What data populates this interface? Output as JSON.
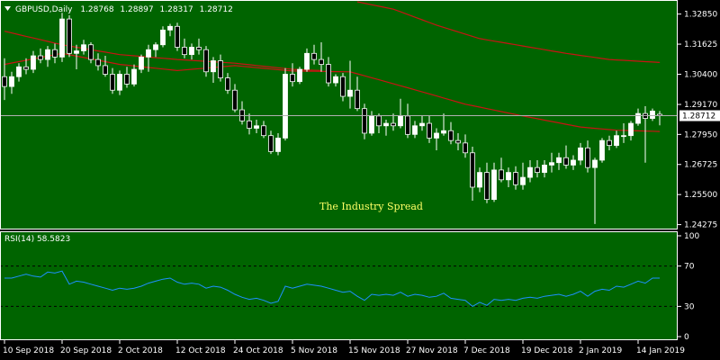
{
  "colors": {
    "background": "#006400",
    "frame": "#000000",
    "grid": "#009b00",
    "axis_text": "#ffffff",
    "bull": "#ffffff",
    "bear": "#000000",
    "wick": "#ffffff",
    "ma": "#c81414",
    "rsi": "#1e90ff",
    "price_line": "#b0b0b0",
    "watermark": "#ffff66"
  },
  "header": {
    "symbol": "GBPUSD,Daily",
    "open": "1.28768",
    "high": "1.28897",
    "low": "1.28317",
    "close": "1.28712"
  },
  "watermark": "The Industry Spread",
  "rsi_panel": {
    "label": "RSI(14) 58.5823",
    "levels": [
      "100",
      "70",
      "30",
      "0"
    ]
  },
  "chart_data": [
    {
      "type": "candlestick",
      "title": "GBPUSD,Daily",
      "grid": false,
      "ylim": [
        1.2415,
        1.3335
      ],
      "y_ticks": [
        "1.32850",
        "1.31625",
        "1.30400",
        "1.29170",
        "1.27950",
        "1.26725",
        "1.25500",
        "1.24275"
      ],
      "current_price": "1.28712",
      "x_tick_labels": [
        "10 Sep 2018",
        "20 Sep 2018",
        "2 Oct 2018",
        "12 Oct 2018",
        "24 Oct 2018",
        "5 Nov 2018",
        "15 Nov 2018",
        "27 Nov 2018",
        "7 Dec 2018",
        "19 Dec 2018",
        "2 Jan 2019",
        "14 Jan 2019"
      ],
      "x_tick_index": [
        0,
        8,
        16,
        24,
        32,
        40,
        48,
        56,
        64,
        72,
        80,
        88
      ],
      "ohlc": [
        [
          1.303,
          1.3105,
          1.2935,
          1.299
        ],
        [
          1.299,
          1.305,
          1.296,
          1.303
        ],
        [
          1.303,
          1.3085,
          1.301,
          1.307
        ],
        [
          1.307,
          1.3105,
          1.304,
          1.306
        ],
        [
          1.306,
          1.3135,
          1.3045,
          1.3115
        ],
        [
          1.3115,
          1.3145,
          1.3085,
          1.31
        ],
        [
          1.31,
          1.3155,
          1.307,
          1.314
        ],
        [
          1.314,
          1.3165,
          1.3085,
          1.311
        ],
        [
          1.311,
          1.329,
          1.309,
          1.3265
        ],
        [
          1.3265,
          1.328,
          1.311,
          1.3125
        ],
        [
          1.3125,
          1.316,
          1.306,
          1.3135
        ],
        [
          1.3135,
          1.318,
          1.312,
          1.316
        ],
        [
          1.316,
          1.317,
          1.3085,
          1.31
        ],
        [
          1.31,
          1.3125,
          1.3055,
          1.3075
        ],
        [
          1.3075,
          1.3115,
          1.303,
          1.304
        ],
        [
          1.304,
          1.3065,
          1.296,
          1.2975
        ],
        [
          1.2975,
          1.3055,
          1.2955,
          1.304
        ],
        [
          1.304,
          1.307,
          1.2985,
          1.3
        ],
        [
          1.3,
          1.308,
          1.299,
          1.306
        ],
        [
          1.306,
          1.312,
          1.3045,
          1.311
        ],
        [
          1.311,
          1.316,
          1.305,
          1.314
        ],
        [
          1.314,
          1.317,
          1.311,
          1.316
        ],
        [
          1.316,
          1.3235,
          1.315,
          1.322
        ],
        [
          1.322,
          1.3245,
          1.3195,
          1.3235
        ],
        [
          1.3235,
          1.325,
          1.3135,
          1.315
        ],
        [
          1.315,
          1.3185,
          1.3105,
          1.312
        ],
        [
          1.312,
          1.3165,
          1.31,
          1.315
        ],
        [
          1.315,
          1.3185,
          1.312,
          1.314
        ],
        [
          1.314,
          1.3155,
          1.303,
          1.305
        ],
        [
          1.305,
          1.311,
          1.3005,
          1.3095
        ],
        [
          1.3095,
          1.312,
          1.301,
          1.3025
        ],
        [
          1.3025,
          1.3045,
          1.296,
          1.2975
        ],
        [
          1.2975,
          1.3,
          1.2885,
          1.2895
        ],
        [
          1.2895,
          1.293,
          1.2835,
          1.285
        ],
        [
          1.285,
          1.288,
          1.2795,
          1.282
        ],
        [
          1.282,
          1.2855,
          1.28,
          1.283
        ],
        [
          1.283,
          1.285,
          1.278,
          1.279
        ],
        [
          1.279,
          1.281,
          1.2715,
          1.2725
        ],
        [
          1.2725,
          1.28,
          1.271,
          1.278
        ],
        [
          1.278,
          1.3065,
          1.277,
          1.304
        ],
        [
          1.304,
          1.3085,
          1.299,
          1.301
        ],
        [
          1.301,
          1.307,
          1.3,
          1.306
        ],
        [
          1.306,
          1.3145,
          1.305,
          1.3125
        ],
        [
          1.3125,
          1.316,
          1.308,
          1.31
        ],
        [
          1.31,
          1.317,
          1.305,
          1.308
        ],
        [
          1.308,
          1.311,
          1.299,
          1.3005
        ],
        [
          1.3005,
          1.304,
          1.299,
          1.303
        ],
        [
          1.303,
          1.3045,
          1.293,
          1.295
        ],
        [
          1.295,
          1.3095,
          1.29,
          1.2975
        ],
        [
          1.2975,
          1.303,
          1.289,
          1.29
        ],
        [
          1.29,
          1.292,
          1.2775,
          1.28
        ],
        [
          1.28,
          1.289,
          1.279,
          1.287
        ],
        [
          1.287,
          1.288,
          1.28,
          1.283
        ],
        [
          1.283,
          1.2855,
          1.279,
          1.284
        ],
        [
          1.284,
          1.288,
          1.281,
          1.283
        ],
        [
          1.283,
          1.294,
          1.282,
          1.287
        ],
        [
          1.287,
          1.292,
          1.278,
          1.2795
        ],
        [
          1.2795,
          1.285,
          1.278,
          1.283
        ],
        [
          1.283,
          1.287,
          1.281,
          1.284
        ],
        [
          1.284,
          1.287,
          1.276,
          1.278
        ],
        [
          1.278,
          1.282,
          1.273,
          1.28
        ],
        [
          1.28,
          1.288,
          1.279,
          1.281
        ],
        [
          1.281,
          1.2845,
          1.2755,
          1.277
        ],
        [
          1.277,
          1.28,
          1.273,
          1.276
        ],
        [
          1.276,
          1.2795,
          1.27,
          1.272
        ],
        [
          1.272,
          1.2745,
          1.2525,
          1.258
        ],
        [
          1.258,
          1.266,
          1.256,
          1.264
        ],
        [
          1.264,
          1.268,
          1.2515,
          1.253
        ],
        [
          1.253,
          1.268,
          1.252,
          1.265
        ],
        [
          1.265,
          1.27,
          1.26,
          1.261
        ],
        [
          1.261,
          1.266,
          1.258,
          1.264
        ],
        [
          1.264,
          1.2665,
          1.257,
          1.259
        ],
        [
          1.259,
          1.268,
          1.257,
          1.262
        ],
        [
          1.262,
          1.269,
          1.26,
          1.266
        ],
        [
          1.266,
          1.269,
          1.262,
          1.264
        ],
        [
          1.264,
          1.269,
          1.262,
          1.267
        ],
        [
          1.267,
          1.272,
          1.264,
          1.268
        ],
        [
          1.268,
          1.272,
          1.265,
          1.27
        ],
        [
          1.27,
          1.275,
          1.2655,
          1.267
        ],
        [
          1.267,
          1.271,
          1.265,
          1.269
        ],
        [
          1.269,
          1.276,
          1.267,
          1.274
        ],
        [
          1.274,
          1.277,
          1.264,
          1.266
        ],
        [
          1.266,
          1.27,
          1.243,
          1.269
        ],
        [
          1.269,
          1.278,
          1.268,
          1.277
        ],
        [
          1.277,
          1.279,
          1.273,
          1.275
        ],
        [
          1.275,
          1.281,
          1.274,
          1.279
        ],
        [
          1.279,
          1.284,
          1.276,
          1.279
        ],
        [
          1.279,
          1.285,
          1.277,
          1.284
        ],
        [
          1.284,
          1.29,
          1.283,
          1.288
        ],
        [
          1.288,
          1.291,
          1.268,
          1.286
        ],
        [
          1.286,
          1.29,
          1.285,
          1.289
        ],
        [
          1.2877,
          1.289,
          1.2832,
          1.2871
        ]
      ],
      "ma_fast_keyframes": [
        [
          0,
          1.308
        ],
        [
          8,
          1.3125
        ],
        [
          16,
          1.308
        ],
        [
          24,
          1.3055
        ],
        [
          32,
          1.3075
        ],
        [
          40,
          1.3053
        ],
        [
          48,
          1.305
        ],
        [
          56,
          1.2985
        ],
        [
          64,
          1.2918
        ],
        [
          72,
          1.287
        ],
        [
          80,
          1.2825
        ],
        [
          85,
          1.2812
        ],
        [
          91,
          1.2807
        ]
      ],
      "ma_slow_keyframes": [
        [
          49,
          1.3335
        ],
        [
          54,
          1.3305
        ],
        [
          60,
          1.324
        ],
        [
          66,
          1.3185
        ],
        [
          72,
          1.3155
        ],
        [
          78,
          1.3125
        ],
        [
          84,
          1.31
        ],
        [
          91,
          1.3088
        ]
      ]
    },
    {
      "type": "line",
      "title": "RSI(14) 58.5823",
      "ylim": [
        0,
        100
      ],
      "y_ticks": [
        "100",
        "70",
        "30",
        "0"
      ],
      "levels": [
        70,
        30
      ],
      "values": [
        58,
        58,
        60,
        62,
        60,
        59,
        64,
        63,
        65,
        52,
        55,
        54,
        52,
        50,
        48,
        46,
        48,
        47,
        48,
        50,
        53,
        55,
        57,
        58,
        54,
        52,
        53,
        52,
        48,
        50,
        49,
        46,
        42,
        39,
        37,
        38,
        36,
        33,
        35,
        50,
        48,
        50,
        52,
        51,
        50,
        48,
        46,
        44,
        45,
        40,
        36,
        42,
        41,
        42,
        41,
        44,
        40,
        42,
        41,
        39,
        40,
        43,
        38,
        37,
        36,
        30,
        34,
        31,
        37,
        36,
        37,
        36,
        38,
        39,
        38,
        40,
        41,
        42,
        40,
        42,
        45,
        40,
        45,
        47,
        46,
        50,
        49,
        52,
        55,
        53,
        58,
        58
      ]
    }
  ]
}
